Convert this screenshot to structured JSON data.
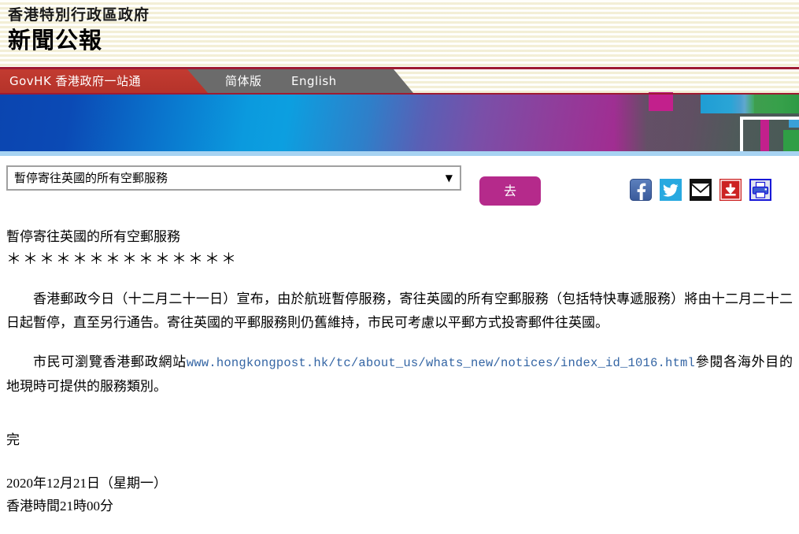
{
  "header": {
    "org_name": "香港特別行政區政府",
    "press_title": "新聞公報"
  },
  "nav": {
    "govhk_label": "GovHK 香港政府一站通",
    "simplified_label": "简体版",
    "english_label": "English"
  },
  "toolbar": {
    "select_value": "暫停寄往英國的所有空郵服務",
    "select_caret": "▼",
    "go_label": "去",
    "social": [
      {
        "name": "facebook-icon",
        "title": "Facebook"
      },
      {
        "name": "twitter-icon",
        "title": "Twitter"
      },
      {
        "name": "email-icon",
        "title": "Email"
      },
      {
        "name": "download-icon",
        "title": "Download"
      },
      {
        "name": "print-icon",
        "title": "Print"
      }
    ]
  },
  "article": {
    "headline": "暫停寄往英國的所有空郵服務",
    "asterisks": "＊＊＊＊＊＊＊＊＊＊＊＊＊＊",
    "paragraph_1": "香港郵政今日（十二月二十一日）宣布，由於航班暫停服務，寄往英國的所有空郵服務（包括特快專遞服務）將由十二月二十二日起暫停，直至另行通告。寄往英國的平郵服務則仍舊維持，市民可考慮以平郵方式投寄郵件往英國。",
    "paragraph_2_prefix": "市民可瀏覽香港郵政網站",
    "paragraph_2_url": "www.hongkongpost.hk/tc/about_us/whats_new/notices/index_id_1016.html",
    "paragraph_2_suffix": "參閱各海外目的地現時可提供的服務類別。",
    "end_mark": "完",
    "date": "2020年12月21日（星期一）",
    "time": "香港時間21時00分"
  },
  "colors": {
    "header_bg": "#fbf8e7",
    "rule_red": "#9e1b32",
    "nav_red": "#c0392f",
    "nav_gray": "#6b6b6b",
    "go_button": "#b52a8b",
    "link_blue": "#3465a4",
    "banner_blue": "#0b45b0",
    "banner_magenta": "#a4278e"
  }
}
